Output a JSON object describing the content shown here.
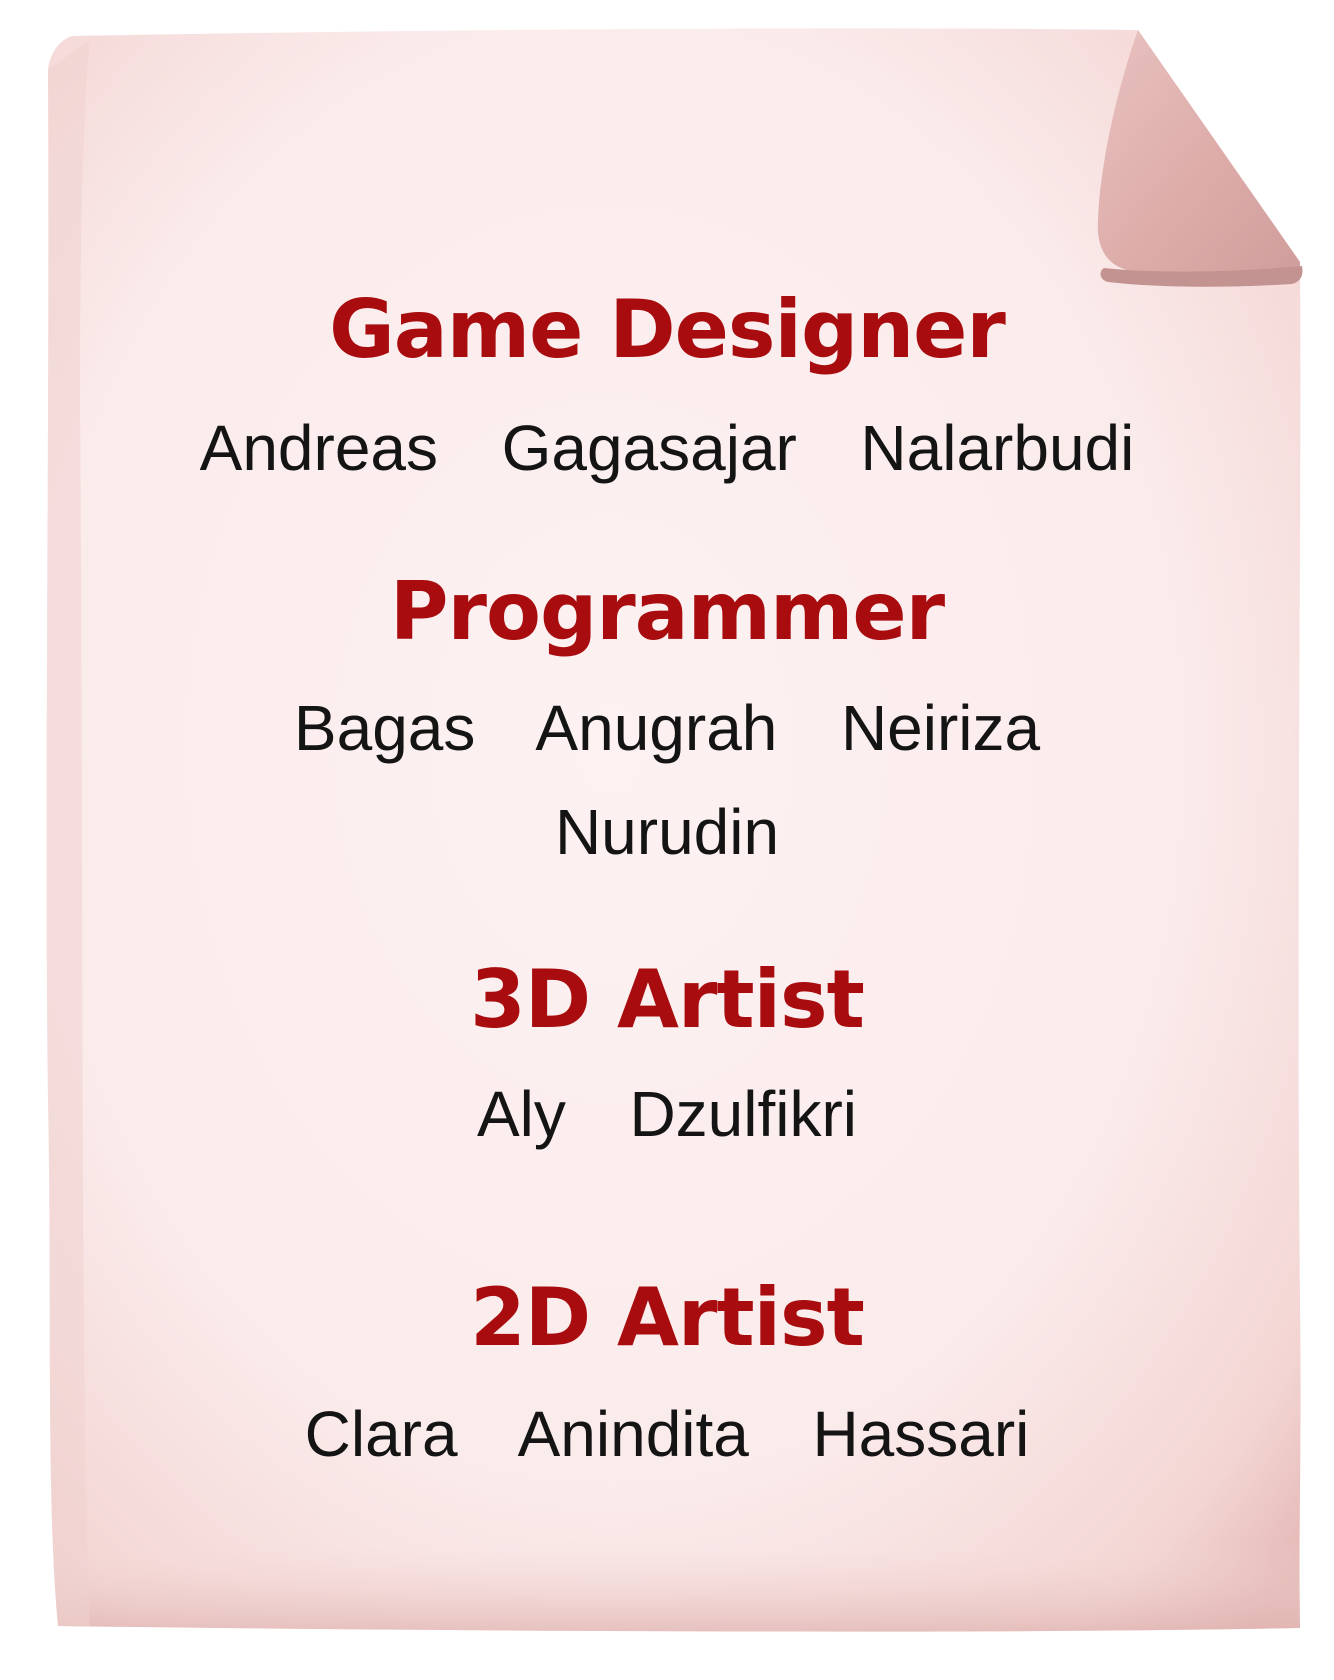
{
  "credits": {
    "sections": [
      {
        "role": "Game Designer",
        "members": [
          "Andreas  Gagasajar  Nalarbudi"
        ]
      },
      {
        "role": "Programmer",
        "members": [
          "Bagas  Anugrah  Neiriza",
          "Nurudin"
        ]
      },
      {
        "role": "3D Artist",
        "members": [
          "Aly  Dzulfikri"
        ]
      },
      {
        "role": "2D Artist",
        "members": [
          "Clara  Anindita  Hassari"
        ]
      }
    ]
  },
  "colors": {
    "paper": "#fbecec",
    "paper_edge": "#e4b8b5",
    "curl": "#dcaaa7",
    "curl_shadow": "#c99896",
    "role_title": "#a80c0e",
    "member_text": "#141414"
  }
}
